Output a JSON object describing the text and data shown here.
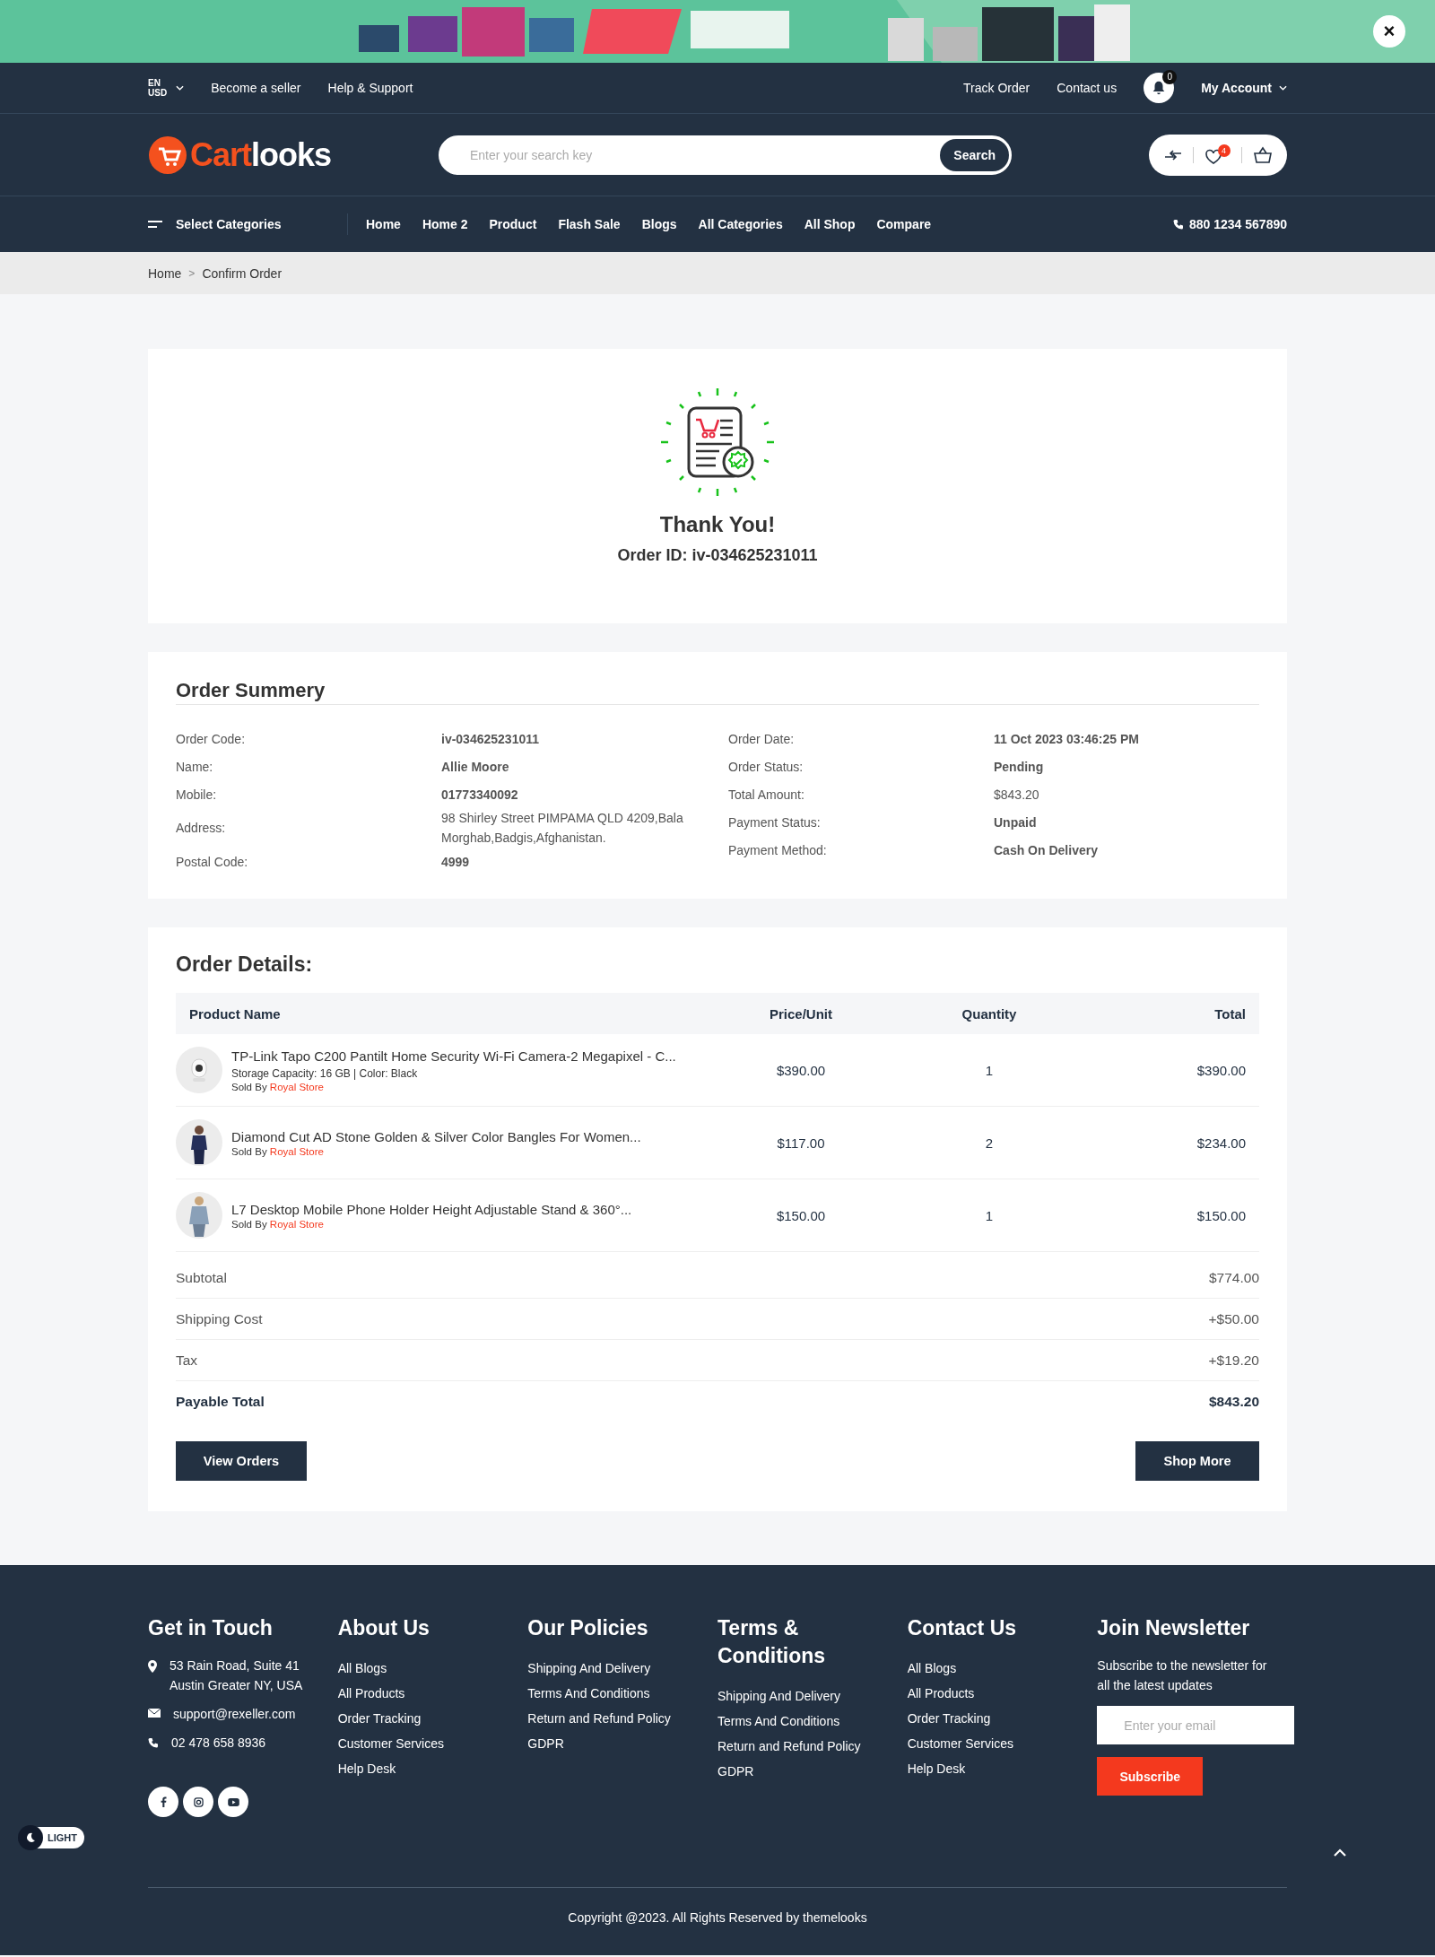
{
  "banner": {
    "kind": "picture",
    "close": "×"
  },
  "topbar": {
    "language": "EN",
    "currency": "USD",
    "left_links": [
      "Become a seller",
      "Help & Support"
    ],
    "right_links": [
      "Track Order",
      "Contact us"
    ],
    "notifications": "0",
    "account": "My Account"
  },
  "header": {
    "logo_accent": "Cart",
    "logo_rest": "looks",
    "search": {
      "placeholder": "Enter your search key",
      "button": "Search"
    },
    "wishlist_count": "4"
  },
  "nav": {
    "categories": "Select Categories",
    "items": [
      "Home",
      "Home 2",
      "Product",
      "Flash Sale",
      "Blogs",
      "All Categories",
      "All Shop",
      "Compare"
    ],
    "phone": "880 1234 567890"
  },
  "breadcrumb": {
    "items": [
      "Home",
      "Confirm Order"
    ],
    "separator": ">"
  },
  "confirmation": {
    "title": "Thank You!",
    "order_id": "Order ID: iv-034625231011"
  },
  "summary": {
    "title": "Order Summery",
    "left": [
      {
        "label": "Order Code:",
        "value": "iv-034625231011",
        "bold": true
      },
      {
        "label": "Name:",
        "value": "Allie Moore",
        "bold": true
      },
      {
        "label": "Mobile:",
        "value": "01773340092",
        "bold": true
      },
      {
        "label": "Address:",
        "value": "98 Shirley Street PIMPAMA QLD 4209,Bala Morghab,Badgis,Afghanistan.",
        "bold": false
      },
      {
        "label": "Postal Code:",
        "value": "4999",
        "bold": true
      }
    ],
    "right": [
      {
        "label": "Order Date:",
        "value": "11 Oct 2023 03:46:25 PM",
        "bold": true
      },
      {
        "label": "Order Status:",
        "value": "Pending",
        "bold": true
      },
      {
        "label": "Total Amount:",
        "value": "$843.20",
        "bold": false
      },
      {
        "label": "Payment Status:",
        "value": "Unpaid",
        "bold": true
      },
      {
        "label": "Payment Method:",
        "value": "Cash On Delivery",
        "bold": true
      }
    ]
  },
  "details": {
    "title": "Order Details:",
    "columns": [
      "Product Name",
      "Price/Unit",
      "Quantity",
      "Total"
    ],
    "rows": [
      {
        "name": "TP-Link Tapo C200 Pantilt Home Security Wi-Fi Camera-2 Megapixel - C...",
        "variant": "Storage Capacity: 16 GB | Color: Black",
        "sold_by": "Sold By",
        "store": "Royal Store",
        "price": "$390.00",
        "quantity": "1",
        "total": "$390.00"
      },
      {
        "name": "Diamond Cut AD Stone Golden & Silver Color Bangles For Women...",
        "sold_by": "Sold By",
        "store": "Royal Store",
        "price": "$117.00",
        "quantity": "2",
        "total": "$234.00"
      },
      {
        "name": "L7 Desktop Mobile Phone Holder Height Adjustable Stand & 360°...",
        "sold_by": "Sold By",
        "store": "Royal Store",
        "price": "$150.00",
        "quantity": "1",
        "total": "$150.00"
      }
    ],
    "totals": [
      {
        "label": "Subtotal",
        "value": "$774.00",
        "bold": false
      },
      {
        "label": "Shipping Cost",
        "value": "+$50.00",
        "bold": false
      },
      {
        "label": "Tax",
        "value": "+$19.20",
        "bold": false
      },
      {
        "label": "Payable Total",
        "value": "$843.20",
        "bold": true
      }
    ],
    "buttons": [
      "View Orders",
      "Shop More"
    ]
  },
  "footer": {
    "contact": {
      "title": "Get in Touch",
      "address": [
        "53 Rain Road, Suite 41",
        "Austin Greater NY, USA"
      ],
      "email": "support@rexeller.com",
      "phone": "02 478 658 8936"
    },
    "columns": [
      {
        "title": "About Us",
        "links": [
          "All Blogs",
          "All Products",
          "Order Tracking",
          "Customer Services",
          "Help Desk"
        ]
      },
      {
        "title": "Our Policies",
        "links": [
          "Shipping And Delivery",
          "Terms And Conditions",
          "Return and Refund Policy",
          "GDPR"
        ]
      },
      {
        "title": "Terms & Conditions",
        "links": [
          "Shipping And Delivery",
          "Terms And Conditions",
          "Return and Refund Policy",
          "GDPR"
        ]
      },
      {
        "title": "Contact Us",
        "links": [
          "All Blogs",
          "All Products",
          "Order Tracking",
          "Customer Services",
          "Help Desk"
        ]
      }
    ],
    "newsletter": {
      "title": "Join Newsletter",
      "text": "Subscribe to the newsletter for all the latest updates",
      "placeholder": "Enter your email",
      "button": "Subscribe"
    },
    "theme_toggle": "LIGHT",
    "copyright": "Copyright @2023. All Rights Reserved by themelooks"
  }
}
